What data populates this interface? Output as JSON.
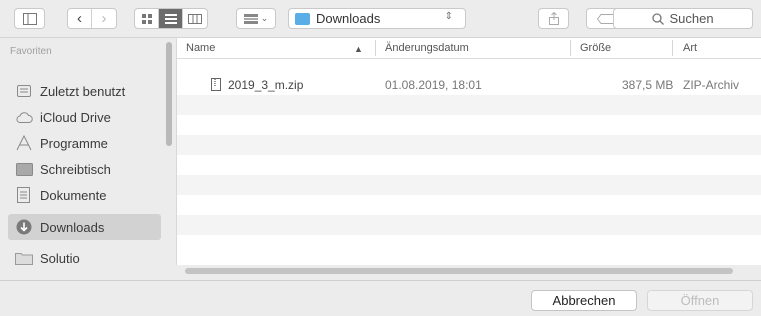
{
  "toolbar": {
    "path_label": "Downloads",
    "search_label": "Suchen"
  },
  "sidebar": {
    "heading": "Favoriten",
    "items": [
      {
        "label": "Zuletzt benutzt",
        "icon": "recents-icon"
      },
      {
        "label": "iCloud Drive",
        "icon": "cloud-icon"
      },
      {
        "label": "Programme",
        "icon": "applications-icon"
      },
      {
        "label": "Schreibtisch",
        "icon": "desktop-icon"
      },
      {
        "label": "Dokumente",
        "icon": "documents-icon"
      },
      {
        "label": "Downloads",
        "icon": "downloads-icon",
        "selected": true
      },
      {
        "label": "Solutio",
        "icon": "folder-icon"
      }
    ]
  },
  "file_list": {
    "columns": {
      "name": "Name",
      "date": "Änderungsdatum",
      "size": "Größe",
      "kind": "Art"
    },
    "rows": [
      {
        "name": "2019_3_m.zip",
        "date": "01.08.2019, 18:01",
        "size": "387,5 MB",
        "kind": "ZIP-Archiv"
      }
    ]
  },
  "footer": {
    "cancel_label": "Abbrechen",
    "open_label": "Öffnen"
  }
}
